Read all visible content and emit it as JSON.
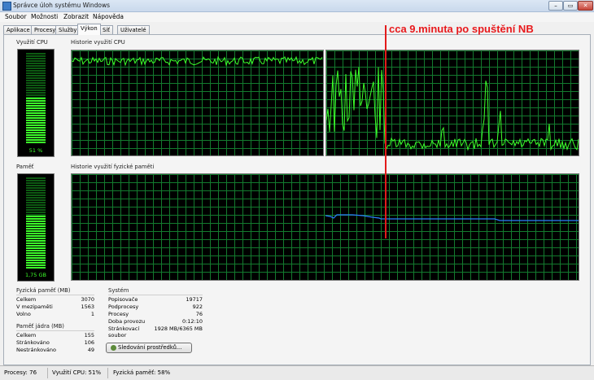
{
  "window": {
    "title": "Správce úloh systému Windows",
    "buttons": {
      "minimize": "–",
      "maximize": "▭",
      "close": "✕"
    }
  },
  "menu": [
    "Soubor",
    "Možnosti",
    "Zobrazit",
    "Nápověda"
  ],
  "tabs": [
    {
      "label": "Aplikace",
      "active": false
    },
    {
      "label": "Procesy",
      "active": false
    },
    {
      "label": "Služby",
      "active": false
    },
    {
      "label": "Výkon",
      "active": true
    },
    {
      "label": "Síť",
      "active": false
    },
    {
      "label": "Uživatelé",
      "active": false
    }
  ],
  "cpu": {
    "usage_label": "Využití CPU",
    "history_label": "Historie využití CPU",
    "usage_value": "51 %",
    "usage_fraction": 0.51
  },
  "memory": {
    "usage_label": "Paměť",
    "history_label": "Historie využití fyzické paměti",
    "usage_value": "1,75 GB",
    "usage_fraction": 0.58
  },
  "physical_memory": {
    "title": "Fyzická paměť (MB)",
    "rows": [
      {
        "label": "Celkem",
        "value": "3070"
      },
      {
        "label": "V mezipaměti",
        "value": "1563"
      },
      {
        "label": "Volno",
        "value": "1"
      }
    ]
  },
  "kernel_memory": {
    "title": "Paměť jádra (MB)",
    "rows": [
      {
        "label": "Celkem",
        "value": "155"
      },
      {
        "label": "Stránkováno",
        "value": "106"
      },
      {
        "label": "Nestránkováno",
        "value": "49"
      }
    ]
  },
  "system": {
    "title": "Systém",
    "rows": [
      {
        "label": "Popisovače",
        "value": "19717"
      },
      {
        "label": "Podprocesy",
        "value": "922"
      },
      {
        "label": "Procesy",
        "value": "76"
      },
      {
        "label": "Doba provozu",
        "value": "0:12:10"
      },
      {
        "label": "Stránkovací soubor",
        "value": "1928 MB/6365 MB"
      }
    ]
  },
  "resource_monitor_button": "Sledování prostředků...",
  "statusbar": {
    "processes": "Procesy: 76",
    "cpu": "Využití CPU: 51%",
    "memory": "Fyzická paměť: 58%"
  },
  "annotation": "cca 9.minuta po spuštění NB",
  "colors": {
    "graph_background": "#000000",
    "grid": "#137a2e",
    "cpu_trace": "#3cff2a",
    "memory_trace": "#2a7fff",
    "annotation": "#e31b1b"
  }
}
